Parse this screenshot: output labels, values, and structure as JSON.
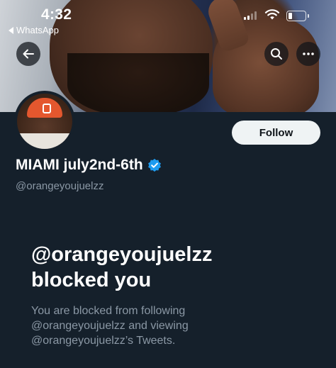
{
  "status_bar": {
    "time": "4:32",
    "return_app_label": "WhatsApp"
  },
  "profile": {
    "display_name": "MIAMI july2nd-6th",
    "verified": true,
    "handle": "@orangeyoujuelzz",
    "follow_label": "Follow"
  },
  "blocked_notice": {
    "title_line1": "@orangeyoujuelzz",
    "title_line2": "blocked you",
    "desc_line1": "You are blocked from following",
    "desc_line2": "@orangeyoujuelzz and viewing",
    "desc_line3": "@orangeyoujuelzz’s Tweets."
  },
  "icons": {
    "back": "arrow-left-icon",
    "search": "search-icon",
    "more": "more-horizontal-icon",
    "verified": "verified-badge-icon"
  },
  "colors": {
    "background": "#15202b",
    "primary_text": "#ffffff",
    "secondary_text": "#8b98a5",
    "verified_blue": "#1d9bf0",
    "follow_button_bg": "#eff3f4"
  }
}
